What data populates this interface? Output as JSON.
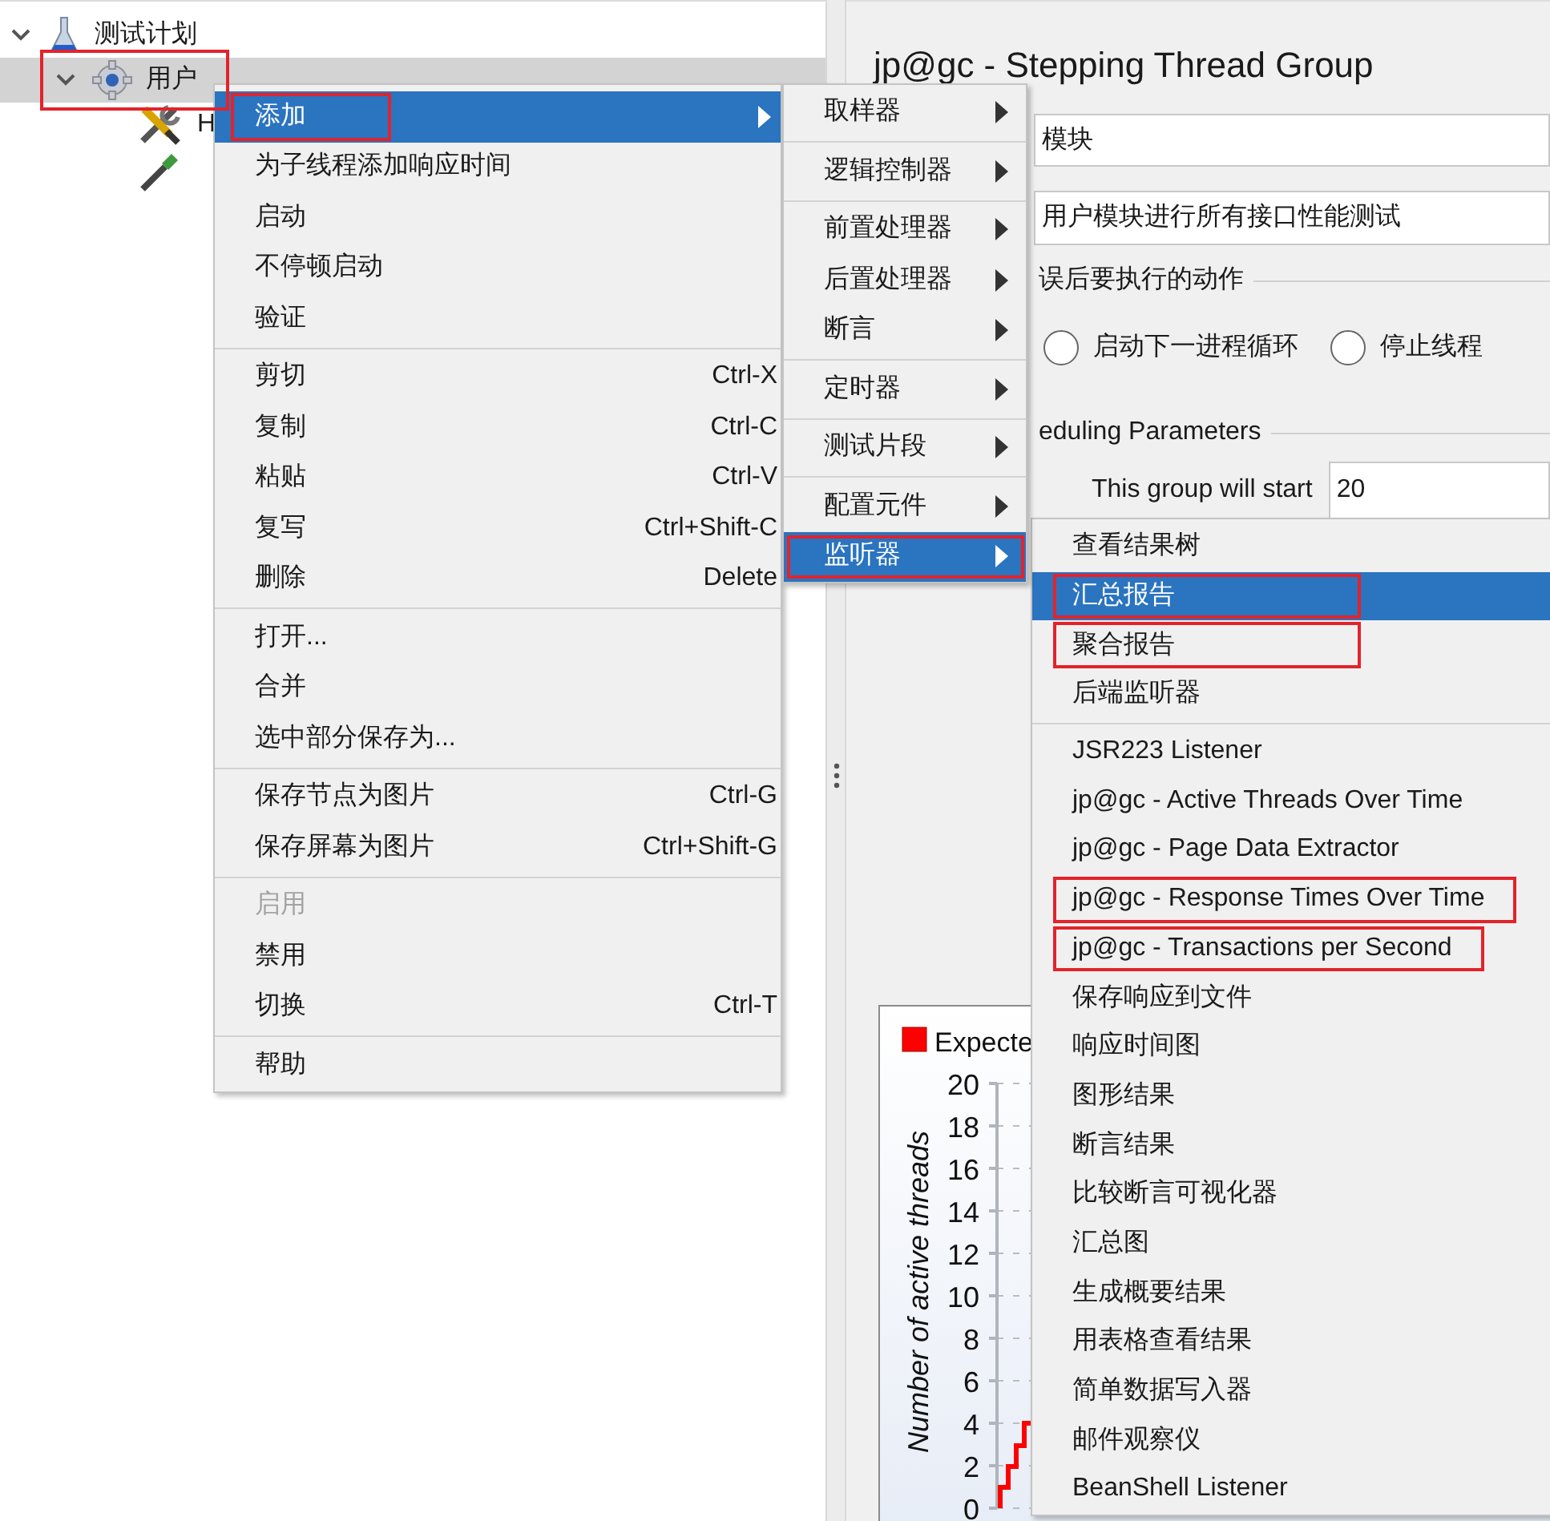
{
  "tree": [
    {
      "label": "测试计划",
      "kind": "plan",
      "expanded": true,
      "selected": false,
      "highlighted": false,
      "children": [
        {
          "label": "用户",
          "kind": "thread-group",
          "expanded": true,
          "selected": true,
          "highlighted": true,
          "children": [
            {
              "label": "H",
              "kind": "sampler",
              "selected": false,
              "highlighted": false
            },
            {
              "kind": "extractor",
              "selected": false,
              "highlighted": false
            }
          ]
        }
      ]
    }
  ],
  "editor": {
    "title": "jp@gc - Stepping Thread Group",
    "name_field": {
      "value": "模块"
    },
    "comment_field": {
      "value": "用户模块进行所有接口性能测试"
    },
    "error_action": {
      "label": "误后要执行的动作",
      "options": [
        {
          "label": "启动下一进程循环",
          "selected": false
        },
        {
          "label": "停止线程",
          "selected": false
        }
      ]
    },
    "scheduling": {
      "label": "eduling Parameters",
      "start_label": "This group will start",
      "start_value": "20"
    },
    "chart": {
      "legend_label": "Expecte",
      "y_axis_title": "Number of active threads",
      "y_tick_labels": [
        "20",
        "18",
        "16",
        "14",
        "12",
        "10",
        "8",
        "6",
        "4",
        "2",
        "0"
      ]
    }
  },
  "context_menu": {
    "items": [
      {
        "kind": "item",
        "label": "添加",
        "submenu": true,
        "selected": true,
        "disabled": false,
        "highlighted": true
      },
      {
        "kind": "item",
        "label": "为子线程添加响应时间",
        "submenu": false,
        "selected": false,
        "disabled": false,
        "highlighted": false
      },
      {
        "kind": "item",
        "label": "启动",
        "submenu": false,
        "selected": false,
        "disabled": false,
        "highlighted": false
      },
      {
        "kind": "item",
        "label": "不停顿启动",
        "submenu": false,
        "selected": false,
        "disabled": false,
        "highlighted": false
      },
      {
        "kind": "item",
        "label": "验证",
        "submenu": false,
        "selected": false,
        "disabled": false,
        "highlighted": false
      },
      {
        "kind": "separator"
      },
      {
        "kind": "item",
        "label": "剪切",
        "shortcut": "Ctrl-X",
        "submenu": false,
        "selected": false,
        "disabled": false,
        "highlighted": false
      },
      {
        "kind": "item",
        "label": "复制",
        "shortcut": "Ctrl-C",
        "submenu": false,
        "selected": false,
        "disabled": false,
        "highlighted": false
      },
      {
        "kind": "item",
        "label": "粘贴",
        "shortcut": "Ctrl-V",
        "submenu": false,
        "selected": false,
        "disabled": false,
        "highlighted": false
      },
      {
        "kind": "item",
        "label": "复写",
        "shortcut": "Ctrl+Shift-C",
        "submenu": false,
        "selected": false,
        "disabled": false,
        "highlighted": false
      },
      {
        "kind": "item",
        "label": "删除",
        "shortcut": "Delete",
        "submenu": false,
        "selected": false,
        "disabled": false,
        "highlighted": false
      },
      {
        "kind": "separator"
      },
      {
        "kind": "item",
        "label": "打开...",
        "submenu": false,
        "selected": false,
        "disabled": false,
        "highlighted": false
      },
      {
        "kind": "item",
        "label": "合并",
        "submenu": false,
        "selected": false,
        "disabled": false,
        "highlighted": false
      },
      {
        "kind": "item",
        "label": "选中部分保存为...",
        "submenu": false,
        "selected": false,
        "disabled": false,
        "highlighted": false
      },
      {
        "kind": "separator"
      },
      {
        "kind": "item",
        "label": "保存节点为图片",
        "shortcut": "Ctrl-G",
        "submenu": false,
        "selected": false,
        "disabled": false,
        "highlighted": false
      },
      {
        "kind": "item",
        "label": "保存屏幕为图片",
        "shortcut": "Ctrl+Shift-G",
        "submenu": false,
        "selected": false,
        "disabled": false,
        "highlighted": false
      },
      {
        "kind": "separator"
      },
      {
        "kind": "item",
        "label": "启用",
        "submenu": false,
        "selected": false,
        "disabled": true,
        "highlighted": false
      },
      {
        "kind": "item",
        "label": "禁用",
        "submenu": false,
        "selected": false,
        "disabled": false,
        "highlighted": false
      },
      {
        "kind": "item",
        "label": "切换",
        "shortcut": "Ctrl-T",
        "submenu": false,
        "selected": false,
        "disabled": false,
        "highlighted": false
      },
      {
        "kind": "separator"
      },
      {
        "kind": "item",
        "label": "帮助",
        "submenu": false,
        "selected": false,
        "disabled": false,
        "highlighted": false
      }
    ]
  },
  "add_submenu": {
    "items": [
      {
        "kind": "item",
        "label": "取样器",
        "submenu": true,
        "selected": false,
        "highlighted": false
      },
      {
        "kind": "separator"
      },
      {
        "kind": "item",
        "label": "逻辑控制器",
        "submenu": true,
        "selected": false,
        "highlighted": false
      },
      {
        "kind": "separator"
      },
      {
        "kind": "item",
        "label": "前置处理器",
        "submenu": true,
        "selected": false,
        "highlighted": false
      },
      {
        "kind": "item",
        "label": "后置处理器",
        "submenu": true,
        "selected": false,
        "highlighted": false
      },
      {
        "kind": "item",
        "label": "断言",
        "submenu": true,
        "selected": false,
        "highlighted": false
      },
      {
        "kind": "separator"
      },
      {
        "kind": "item",
        "label": "定时器",
        "submenu": true,
        "selected": false,
        "highlighted": false
      },
      {
        "kind": "separator"
      },
      {
        "kind": "item",
        "label": "测试片段",
        "submenu": true,
        "selected": false,
        "highlighted": false
      },
      {
        "kind": "separator"
      },
      {
        "kind": "item",
        "label": "配置元件",
        "submenu": true,
        "selected": false,
        "highlighted": false
      },
      {
        "kind": "item",
        "label": "监听器",
        "submenu": true,
        "selected": true,
        "highlighted": true
      }
    ]
  },
  "listener_submenu": {
    "items": [
      {
        "kind": "item",
        "label": "查看结果树",
        "selected": false,
        "highlighted": false
      },
      {
        "kind": "item",
        "label": "汇总报告",
        "selected": true,
        "highlighted": true
      },
      {
        "kind": "item",
        "label": "聚合报告",
        "selected": false,
        "highlighted": true
      },
      {
        "kind": "item",
        "label": "后端监听器",
        "selected": false,
        "highlighted": false
      },
      {
        "kind": "separator"
      },
      {
        "kind": "item",
        "label": "JSR223 Listener",
        "selected": false,
        "highlighted": false
      },
      {
        "kind": "item",
        "label": "jp@gc - Active Threads Over Time",
        "selected": false,
        "highlighted": false
      },
      {
        "kind": "item",
        "label": "jp@gc - Page Data Extractor",
        "selected": false,
        "highlighted": false
      },
      {
        "kind": "item",
        "label": "jp@gc - Response Times Over Time",
        "selected": false,
        "highlighted": true
      },
      {
        "kind": "item",
        "label": "jp@gc - Transactions per Second",
        "selected": false,
        "highlighted": true
      },
      {
        "kind": "item",
        "label": "保存响应到文件",
        "selected": false,
        "highlighted": false
      },
      {
        "kind": "item",
        "label": "响应时间图",
        "selected": false,
        "highlighted": false
      },
      {
        "kind": "item",
        "label": "图形结果",
        "selected": false,
        "highlighted": false
      },
      {
        "kind": "item",
        "label": "断言结果",
        "selected": false,
        "highlighted": false
      },
      {
        "kind": "item",
        "label": "比较断言可视化器",
        "selected": false,
        "highlighted": false
      },
      {
        "kind": "item",
        "label": "汇总图",
        "selected": false,
        "highlighted": false
      },
      {
        "kind": "item",
        "label": "生成概要结果",
        "selected": false,
        "highlighted": false
      },
      {
        "kind": "item",
        "label": "用表格查看结果",
        "selected": false,
        "highlighted": false
      },
      {
        "kind": "item",
        "label": "简单数据写入器",
        "selected": false,
        "highlighted": false
      },
      {
        "kind": "item",
        "label": "邮件观察仪",
        "selected": false,
        "highlighted": false
      },
      {
        "kind": "item",
        "label": "BeanShell Listener",
        "selected": false,
        "highlighted": false
      }
    ]
  }
}
